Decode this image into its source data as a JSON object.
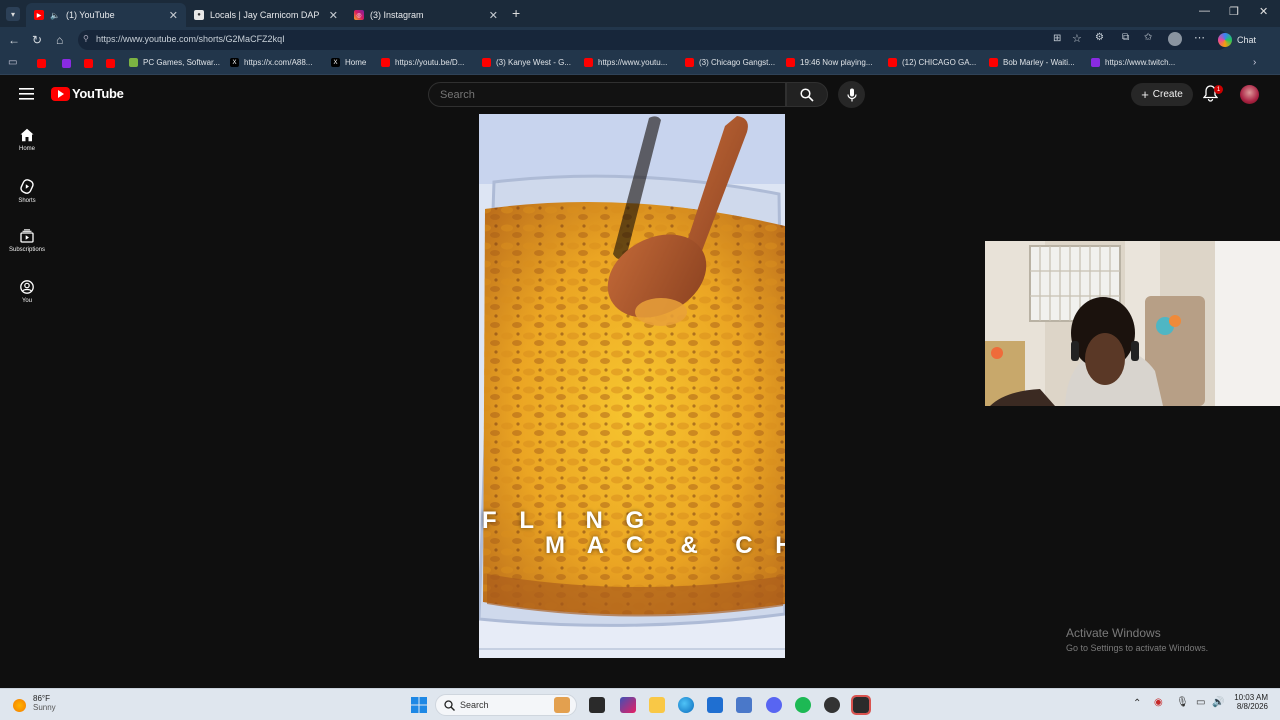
{
  "browser": {
    "tabs": [
      {
        "label": "(1) YouTube",
        "active": true
      },
      {
        "label": "Locals | Jay Carnicom DAP",
        "active": false
      },
      {
        "label": "(3) Instagram",
        "active": false
      }
    ],
    "url": "https://www.youtube.com/shorts/G2MaCFZ2kqI",
    "chat_label": "Chat",
    "favorites": [
      "PC Games, Softwar...",
      "https://x.com/A88...",
      "Home",
      "https://youtu.be/D...",
      "(3) Kanye West - G...",
      "https://www.youtu...",
      "(3) Chicago Gangst...",
      "19:46 Now playing...",
      "(12) CHICAGO GA...",
      "Bob Marley - Waiti...",
      "https://www.twitch..."
    ]
  },
  "youtube": {
    "logo_text": "YouTube",
    "search_placeholder": "Search",
    "create_label": "Create",
    "notification_count": "1",
    "sidebar": [
      {
        "label": "Home",
        "icon": "home-icon"
      },
      {
        "label": "Shorts",
        "icon": "shorts-icon"
      },
      {
        "label": "Subscriptions",
        "icon": "subscriptions-icon"
      },
      {
        "label": "You",
        "icon": "you-icon"
      }
    ],
    "short_caption_line1": "F L I N G",
    "short_caption_line2": "M A C  &  C H"
  },
  "activation": {
    "title": "Activate Windows",
    "subtitle": "Go to Settings to activate Windows."
  },
  "taskbar": {
    "weather_temp": "86°F",
    "weather_desc": "Sunny",
    "search_label": "Search",
    "time": "10:03 AM",
    "date": "8/8/2026"
  },
  "colors": {
    "youtube_red": "#ff0000",
    "background": "#0f0f0f",
    "browser_frame": "#22364b"
  }
}
